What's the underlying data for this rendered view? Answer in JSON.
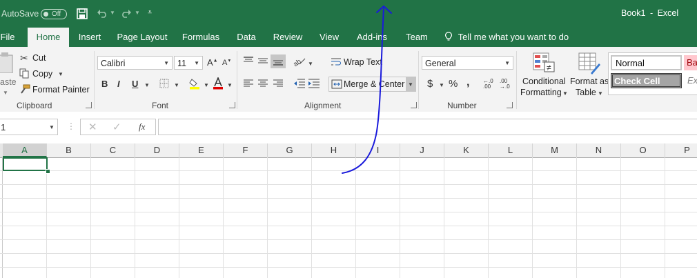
{
  "titlebar": {
    "autosave_label": "AutoSave",
    "autosave_state": "Off",
    "book_title": "Book1",
    "separator": "-",
    "app_name": "Excel"
  },
  "tabs": [
    "File",
    "Home",
    "Insert",
    "Page Layout",
    "Formulas",
    "Data",
    "Review",
    "View",
    "Add-ins",
    "Team"
  ],
  "tell_me": "Tell me what you want to do",
  "clipboard": {
    "paste": "aste",
    "cut": "Cut",
    "copy": "Copy",
    "format_painter": "Format Painter",
    "label": "Clipboard"
  },
  "font": {
    "name": "Calibri",
    "size": "11",
    "bold": "B",
    "italic": "I",
    "underline": "U",
    "label": "Font"
  },
  "alignment": {
    "wrap_text": "Wrap Text",
    "merge_center": "Merge & Center",
    "label": "Alignment"
  },
  "number": {
    "format": "General",
    "currency": "$",
    "percent": "%",
    "comma": ",",
    "inc_decimal": "←.0 .00",
    "dec_decimal": ".00 →.0",
    "label": "Number"
  },
  "styles": {
    "conditional_1": "Conditional",
    "conditional_2": "Formatting",
    "format_as_1": "Format as",
    "format_as_2": "Table",
    "normal": "Normal",
    "bad": "Ba",
    "check_cell": "Check Cell",
    "explanatory": "Ex"
  },
  "formula_bar": {
    "name_box": "1",
    "fx": "fx",
    "formula": ""
  },
  "columns": [
    "A",
    "B",
    "C",
    "D",
    "E",
    "F",
    "G",
    "H",
    "I",
    "J",
    "K",
    "L",
    "M",
    "N",
    "O",
    "P"
  ],
  "colors": {
    "brand_green": "#217346",
    "annotation_blue": "#1a1adb",
    "bad_fill": "#ffc7ce",
    "bad_text": "#9c0006"
  }
}
